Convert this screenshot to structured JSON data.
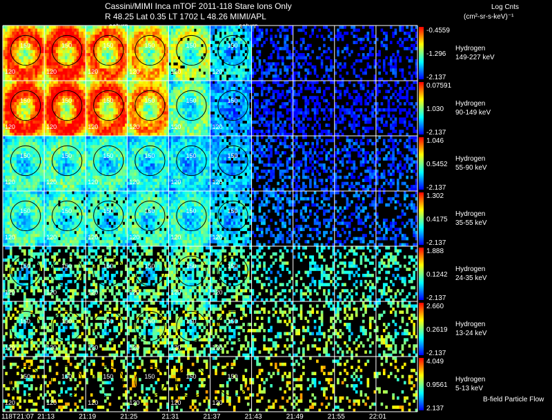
{
  "header": {
    "title_line1": "Cassini/MIMI Inca mTOF  2011-118   Stare   Ions Only",
    "title_line2": "R       48.25 Lat 0.35 LT 1702 L       48.26  MIMI/APL",
    "saturn_labels": [
      "saturn",
      "saturn"
    ]
  },
  "colorbar_title": [
    "Log Cnts",
    "(cm²-sr-s-keV)⁻¹"
  ],
  "footer_note": "B-field Particle Flow",
  "colors": {
    "background": "#000000",
    "grid_line": "#ffffff",
    "colorscale": [
      "#0000ff",
      "#0080ff",
      "#00ffff",
      "#80ff80",
      "#ffff00",
      "#ff8000",
      "#ff0000"
    ]
  },
  "chart_data": {
    "type": "heatmap",
    "x_label": "",
    "times": [
      "118T21:07",
      "21:13",
      "21:19",
      "21:25",
      "21:31",
      "21:37",
      "21:43",
      "21:49",
      "21:55",
      "22:01"
    ],
    "rows": [
      {
        "species": "Hydrogen",
        "energy": "149-227 keV",
        "cb_max": "-0.4559",
        "cb_mid": "-1.296",
        "cb_min": "-2.137",
        "intensity": [
          0.85,
          0.9,
          0.8,
          0.7,
          0.55,
          0.3,
          0.05,
          0.03,
          0.03,
          0.03
        ],
        "fill": [
          1.0,
          1.0,
          1.0,
          1.0,
          0.95,
          0.85,
          0.4,
          0.3,
          0.3,
          0.3
        ]
      },
      {
        "species": "Hydrogen",
        "energy": "90-149 keV",
        "cb_max": "0.07591",
        "cb_mid": "1.030",
        "cb_min": "-2.137",
        "intensity": [
          0.9,
          0.92,
          0.85,
          0.75,
          0.45,
          0.2,
          0.02,
          0.0,
          0.0,
          0.0
        ],
        "fill": [
          1.0,
          1.0,
          1.0,
          1.0,
          1.0,
          0.9,
          0.5,
          0.4,
          0.4,
          0.4
        ]
      },
      {
        "species": "Hydrogen",
        "energy": "55-90 keV",
        "cb_max": "1.046",
        "cb_mid": "0.5452",
        "cb_min": "-2.137",
        "intensity": [
          0.4,
          0.42,
          0.38,
          0.35,
          0.3,
          0.25,
          0.1,
          0.08,
          0.08,
          0.08
        ],
        "fill": [
          1.0,
          1.0,
          1.0,
          1.0,
          1.0,
          0.9,
          0.45,
          0.4,
          0.4,
          0.4
        ]
      },
      {
        "species": "Hydrogen",
        "energy": "35-55 keV",
        "cb_max": "1.302",
        "cb_mid": "0.4175",
        "cb_min": "-2.137",
        "intensity": [
          0.4,
          0.4,
          0.38,
          0.4,
          0.38,
          0.3,
          0.15,
          0.12,
          0.12,
          0.12
        ],
        "fill": [
          1.0,
          0.95,
          0.9,
          0.95,
          1.0,
          0.8,
          0.4,
          0.35,
          0.35,
          0.35
        ]
      },
      {
        "species": "Hydrogen",
        "energy": "24-35 keV",
        "cb_max": "1.888",
        "cb_mid": "0.1242",
        "cb_min": "-2.137",
        "intensity": [
          0.45,
          0.45,
          0.45,
          0.45,
          0.45,
          0.45,
          0.4,
          0.4,
          0.4,
          0.4
        ],
        "fill": [
          0.5,
          0.45,
          0.45,
          0.55,
          0.7,
          0.5,
          0.3,
          0.3,
          0.3,
          0.3
        ]
      },
      {
        "species": "Hydrogen",
        "energy": "13-24 keV",
        "cb_max": "2.660",
        "cb_mid": "0.2619",
        "cb_min": "-2.137",
        "intensity": [
          0.5,
          0.5,
          0.5,
          0.5,
          0.5,
          0.5,
          0.5,
          0.5,
          0.5,
          0.5
        ],
        "fill": [
          0.5,
          0.45,
          0.45,
          0.55,
          0.55,
          0.35,
          0.3,
          0.3,
          0.3,
          0.3
        ]
      },
      {
        "species": "Hydrogen",
        "energy": "5-13 keV",
        "cb_max": "4.049",
        "cb_mid": "0.9561",
        "cb_min": "2.137",
        "intensity": [
          0.6,
          0.6,
          0.6,
          0.6,
          0.6,
          0.6,
          0.6,
          0.6,
          0.6,
          0.6
        ],
        "fill": [
          0.25,
          0.25,
          0.25,
          0.25,
          0.25,
          0.2,
          0.2,
          0.2,
          0.2,
          0.2
        ]
      }
    ],
    "contour_labels": [
      "120",
      "150"
    ]
  }
}
